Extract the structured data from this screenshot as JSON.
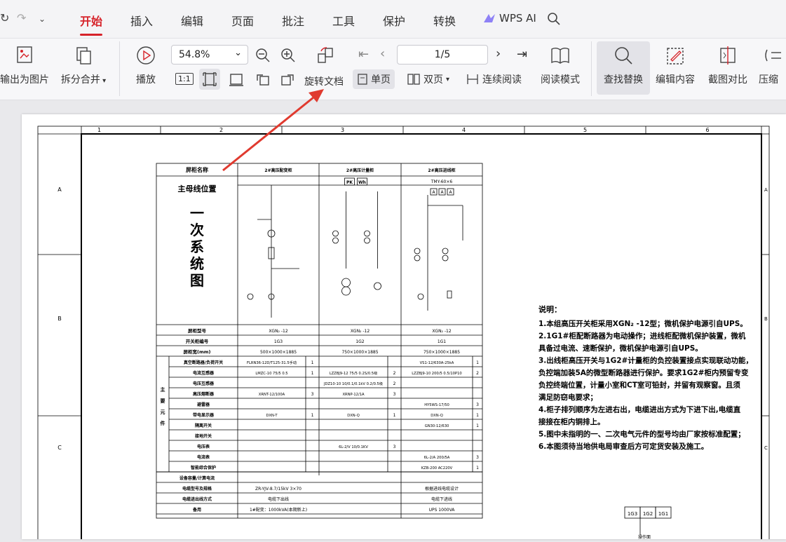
{
  "menu": {
    "tabs": [
      "开始",
      "插入",
      "编辑",
      "页面",
      "批注",
      "工具",
      "保护",
      "转换"
    ],
    "ai_label": "WPS AI",
    "active_tab": "开始"
  },
  "ribbon": {
    "export_image": "输出为图片",
    "split_merge": "拆分合并",
    "play": "播放",
    "zoom": "54.8%",
    "rotate_doc": "旋转文档",
    "single_page": "单页",
    "double_page": "双页",
    "continuous": "连续阅读",
    "page_box": "1/5",
    "read_mode": "阅读模式",
    "find_replace": "查找替换",
    "edit_content": "编辑内容",
    "compare": "截图对比",
    "compress": "压缩",
    "fit_actual": "1:1"
  },
  "drawing": {
    "col_numbers": [
      "1",
      "2",
      "3",
      "4",
      "5",
      "6"
    ],
    "row_letters": [
      "A",
      "B",
      "C"
    ],
    "header": {
      "cabinet_name": "屏柜名称",
      "busbar": "主母线位置",
      "system_title": [
        "一",
        "次",
        "系",
        "统",
        "图"
      ],
      "col1": "2#高压配变柜",
      "col2": "2#高压计量柜",
      "col3": "2#高压进线柜",
      "busbar3": "TMY-60×6"
    },
    "rows": [
      {
        "label": "屏柜型号",
        "c1": "XGN₂ -12",
        "c2": "XGN₂ -12",
        "c3": "XGN₂ -12"
      },
      {
        "label": "开关柜编号",
        "c1": "1G3",
        "c2": "1G2",
        "c3": "1G1"
      },
      {
        "label": "屏柜宽(mm)",
        "c1": "500×1000×1885",
        "c2": "750×1000×1885",
        "c3": "750×1000×1885"
      }
    ],
    "main_components_label": "主要元件",
    "components": [
      {
        "label": "真空断路器/负荷开关",
        "c1": "FLRN36-12D/T125-31.5手动",
        "n1": "1",
        "c2": "",
        "n2": "",
        "c3": "VS1-12/630A-25kA",
        "n3": "1"
      },
      {
        "label": "电流互感器",
        "c1": "LMZC-10 75/5 0.5",
        "n1": "1",
        "c2": "LZZBJ9-12 75/5 0.2S/0.5级",
        "n2": "2",
        "c3": "LZZBJ9-10 200/5 0.5/10P10",
        "n3": "2"
      },
      {
        "label": "电压互感器",
        "c1": "",
        "n1": "",
        "c2": "JDZ10-10 10/0.1/0.1kV 0.2/0.5级",
        "n2": "2",
        "c3": "",
        "n3": ""
      },
      {
        "label": "高压熔断器",
        "c1": "XRNT-12/100A",
        "n1": "3",
        "c2": "XRNP-12/1A",
        "n2": "3",
        "c3": "",
        "n3": ""
      },
      {
        "label": "避雷器",
        "c1": "",
        "n1": "",
        "c2": "",
        "n2": "",
        "c3": "HY5WS-17/50",
        "n3": "3"
      },
      {
        "label": "带电显示器",
        "c1": "DXN-T",
        "n1": "1",
        "c2": "DXN-Q",
        "n2": "1",
        "c3": "DXN-Q",
        "n3": "1"
      },
      {
        "label": "隔离开关",
        "c1": "",
        "n1": "",
        "c2": "",
        "n2": "",
        "c3": "GN30-12/630",
        "n3": "1"
      },
      {
        "label": "接地开关",
        "c1": "",
        "n1": "",
        "c2": "",
        "n2": "",
        "c3": "",
        "n3": ""
      },
      {
        "label": "电压表",
        "c1": "",
        "n1": "",
        "c2": "6L-2/V 10/0.1KV",
        "n2": "3",
        "c3": "",
        "n3": ""
      },
      {
        "label": "电流表",
        "c1": "",
        "n1": "",
        "c2": "",
        "n2": "",
        "c3": "6L-2/A 200/5A",
        "n3": "3"
      },
      {
        "label": "智能综合保护",
        "c1": "",
        "n1": "",
        "c2": "",
        "n2": "",
        "c3": "KZB-200 AC220V",
        "n3": "1"
      }
    ],
    "footer_rows": [
      {
        "label": "设备容量/计算电流",
        "c1": "",
        "c2": "",
        "c3": ""
      },
      {
        "label": "电缆型号及规格",
        "c1": "ZR-YJV-8.7/15kV 3×70",
        "c2": "",
        "c3": "根据进线电缆设计"
      },
      {
        "label": "电缆进出线方式",
        "c1": "电缆下出线",
        "c2": "",
        "c3": "电缆下进线"
      },
      {
        "label": "备用",
        "c1": "1#配变：1000kVA(本期新上)",
        "c2": "",
        "c3": "UPS 1000VA"
      }
    ],
    "meter_labels": [
      "PK",
      "Wh"
    ],
    "notes_title": "说明：",
    "notes": [
      "1.本组高压开关柜采用XGN₂ -12型；微机保护电源引自UPS。",
      "2.1G1#柜配断路器为电动操作；进线柜配微机保护装置，微机",
      "具备过电流、速断保护，微机保护电源引自UPS。",
      "3.出线柜高压开关与1G2#计量柜的负控装置接点实现联动功能，",
      "负控端加装5A的微型断路器进行保护。要求1G2#柜内预留专变",
      "负控终端位置，计量小室和CT室可铅封，并留有观察窗。且须",
      "满足防窃电要求；",
      "4.柜子排列顺序为左进右出，电缆进出方式为下进下出,电缆直",
      "接接在柜内铜排上。",
      "5.图中未指明的一、二次电气元件的型号均由厂家按标准配置；",
      "6.本图须待当地供电局审查后方可定货安装及施工。"
    ],
    "layout_boxes": [
      "1G3",
      "1G2",
      "1G1"
    ],
    "layout_caption": "操作面"
  },
  "colors": {
    "accent": "#d6232a",
    "arrow": "#e03a2f"
  }
}
